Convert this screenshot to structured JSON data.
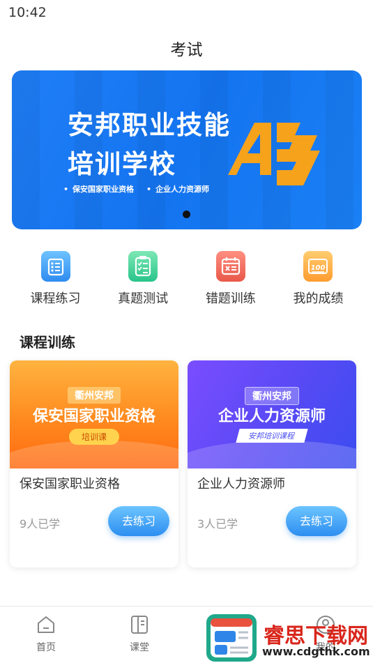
{
  "status_bar": {
    "time": "10:42"
  },
  "nav": {
    "title": "考试"
  },
  "banner": {
    "title_line1": "安邦职业技能",
    "title_line2": "培训学校",
    "tag1": "保安国家职业资格",
    "tag2": "企业人力资源师",
    "logo_text": "AB",
    "slide_count": 1,
    "active_slide": 1
  },
  "quick_nav": [
    {
      "label": "课程练习",
      "icon": "list-icon",
      "color": "#2e8bf0"
    },
    {
      "label": "真题测试",
      "icon": "clipboard-checklist-icon",
      "color": "#27c48a"
    },
    {
      "label": "错题训练",
      "icon": "calendar-x-icon",
      "color": "#e8584a"
    },
    {
      "label": "我的成绩",
      "icon": "score-100-icon",
      "color": "#ff9c2f"
    }
  ],
  "section": {
    "title": "课程训练"
  },
  "courses": [
    {
      "cover_pill": "衢州安邦",
      "cover_title": "保安国家职业资格",
      "cover_sub": "培训课",
      "name": "保安国家职业资格",
      "learners": "9人已学",
      "button": "去练习"
    },
    {
      "cover_pill": "衢州安邦",
      "cover_title": "企业人力资源师",
      "cover_sub": "安邦培训课程",
      "name": "企业人力资源师",
      "learners": "3人已学",
      "button": "去练习"
    }
  ],
  "tabbar": [
    {
      "label": "首页",
      "icon": "home-icon"
    },
    {
      "label": "课堂",
      "icon": "book-icon"
    },
    {
      "label": "我的",
      "icon": "user-icon"
    }
  ],
  "watermark": {
    "text": "睿思下载网",
    "url": "www.cdgthk.com"
  },
  "colors": {
    "primary": "#2d8ef0",
    "banner": "#1474f0",
    "watermark_red": "#d9261c"
  }
}
